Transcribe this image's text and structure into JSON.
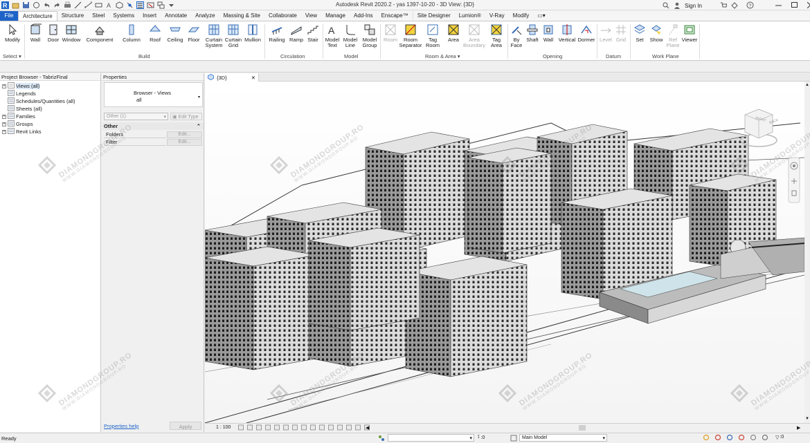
{
  "window": {
    "title": "Autodesk Revit 2020.2 - yas 1397-10-20 - 3D View: {3D}",
    "sign_in": "Sign In",
    "help": "?"
  },
  "tabs": [
    "File",
    "Architecture",
    "Structure",
    "Steel",
    "Systems",
    "Insert",
    "Annotate",
    "Analyze",
    "Massing & Site",
    "Collaborate",
    "View",
    "Manage",
    "Add-Ins",
    "Enscape™",
    "Site Designer",
    "Lumion®",
    "V-Ray",
    "Modify"
  ],
  "ribbon": {
    "select": {
      "modify": "Modify",
      "select_label": "Select"
    },
    "build": {
      "label": "Build",
      "tools": [
        "Wall",
        "Door",
        "Window",
        "Component",
        "Column",
        "Roof",
        "Ceiling",
        "Floor",
        "Curtain System",
        "Curtain Grid",
        "Mullion"
      ]
    },
    "circulation": {
      "label": "Circulation",
      "tools": [
        "Railing",
        "Ramp",
        "Stair"
      ]
    },
    "model": {
      "label": "Model",
      "tools": [
        "Model Text",
        "Model Line",
        "Model Group"
      ]
    },
    "room_area": {
      "label": "Room & Area",
      "tools": [
        "Room",
        "Room Separator",
        "Tag Room",
        "Area",
        "Area Boundary",
        "Tag Area"
      ]
    },
    "opening": {
      "label": "Opening",
      "tools": [
        "By Face",
        "Shaft",
        "Wall",
        "Vertical",
        "Dormer"
      ]
    },
    "datum": {
      "label": "Datum",
      "tools": [
        "Level",
        "Grid"
      ]
    },
    "work_plane": {
      "label": "Work Plane",
      "tools": [
        "Set",
        "Show",
        "Ref Plane",
        "Viewer"
      ]
    }
  },
  "project_browser": {
    "title": "Project Browser - TabrizFinal",
    "items": [
      {
        "label": "Views (all)",
        "expander": "+"
      },
      {
        "label": "Legends",
        "expander": ""
      },
      {
        "label": "Schedules/Quantities (all)",
        "expander": ""
      },
      {
        "label": "Sheets (all)",
        "expander": ""
      },
      {
        "label": "Families",
        "expander": "+"
      },
      {
        "label": "Groups",
        "expander": "+"
      },
      {
        "label": "Revit Links",
        "expander": "+"
      }
    ]
  },
  "properties": {
    "title": "Properties",
    "type_line1": "Browser - Views",
    "type_line2": "all",
    "filter_value": "Other (1)",
    "edit_type": "Edit Type",
    "section": "Other",
    "rows": [
      {
        "name": "Folders",
        "value": "Edit..."
      },
      {
        "name": "Filter",
        "value": "Edit..."
      }
    ],
    "help_link": "Properties help",
    "apply": "Apply"
  },
  "view": {
    "tab_label": "{3D}",
    "scale": "1 : 100",
    "viewcube_right": "RIGHT",
    "viewcube_back": "BACK"
  },
  "status": {
    "text": "Ready",
    "coord": ":0",
    "model": "Main Model",
    "filter_count": ":0"
  },
  "watermark": {
    "line1": "DIAMONDGROUP.RO",
    "line2": "WWW.DIAMONDGROUP.RO"
  },
  "colors": {
    "file_tab": "#1e64c8",
    "accent": "#1e64c8",
    "building": "#8e8e8e",
    "building_dark": "#4a4a4a"
  }
}
